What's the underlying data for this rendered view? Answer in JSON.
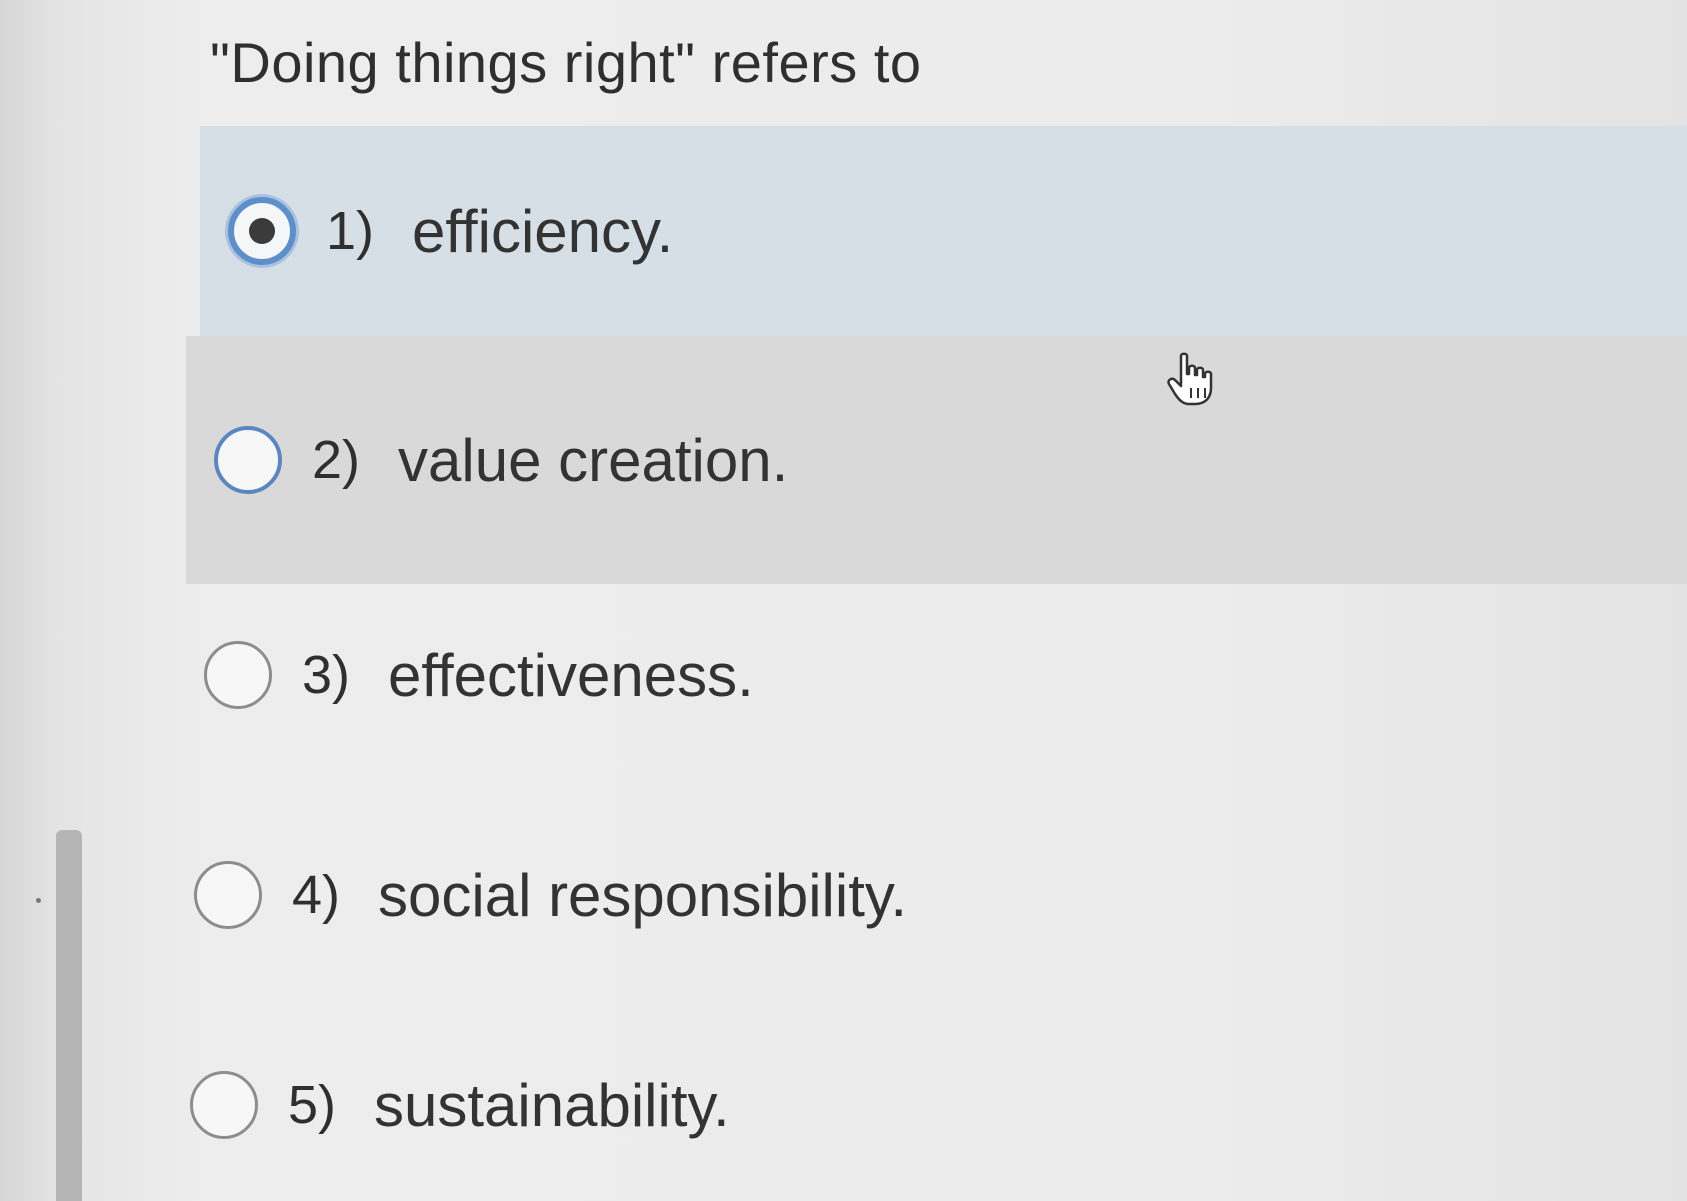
{
  "question": {
    "text": "\"Doing things right\" refers to"
  },
  "options": [
    {
      "number": "1)",
      "label": "efficiency.",
      "selected": true
    },
    {
      "number": "2)",
      "label": "value creation.",
      "selected": false
    },
    {
      "number": "3)",
      "label": "effectiveness.",
      "selected": false
    },
    {
      "number": "4)",
      "label": "social responsibility.",
      "selected": false
    },
    {
      "number": "5)",
      "label": "sustainability.",
      "selected": false
    }
  ],
  "colors": {
    "selected_row": "#d7dfe6",
    "hover_row": "#d9d9d9",
    "radio_accent": "#5f8fc9"
  },
  "icons": {
    "cursor": "hand-pointer-icon"
  }
}
